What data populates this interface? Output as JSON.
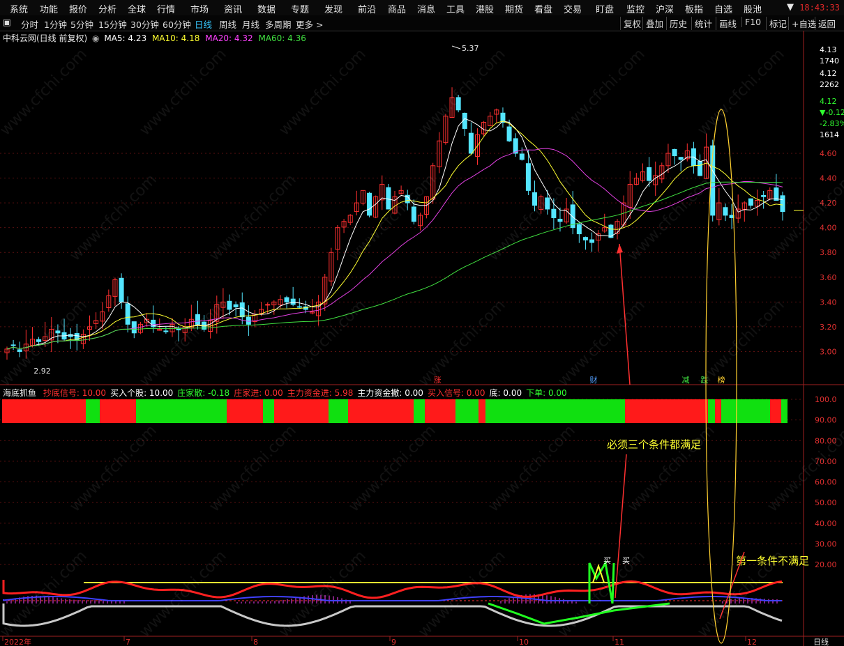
{
  "menu": [
    "系统",
    "功能",
    "报价",
    "分析",
    "全球",
    "行情",
    "市场",
    "资讯",
    "数据",
    "专题",
    "发现",
    "前沿",
    "商品",
    "消息",
    "工具",
    "港股",
    "期货",
    "看盘",
    "交易",
    "盯盘",
    "监控",
    "沪深",
    "板指",
    "自选",
    "股池"
  ],
  "clock": "18:43:33",
  "toolbar": {
    "left": [
      "分时",
      "1分钟",
      "5分钟",
      "15分钟",
      "30分钟",
      "60分钟",
      "日线",
      "周线",
      "月线",
      "多周期",
      "更多 >"
    ],
    "active": "日线",
    "right": [
      "复权",
      "叠加",
      "历史",
      "统计",
      "画线",
      "F10",
      "标记",
      "+自选",
      "返回"
    ]
  },
  "main_info": {
    "title": "中科云网(日线 前复权)",
    "ma5": "MA5: 4.23",
    "ma10": "MA10: 4.18",
    "ma20": "MA20: 4.32",
    "ma60": "MA60: 4.36"
  },
  "price_axis": {
    "ticks": [
      "4.60",
      "4.40",
      "4.20",
      "4.00",
      "3.80",
      "3.60",
      "3.40",
      "3.20",
      "3.00"
    ],
    "quote": [
      "4.13",
      "1740",
      "4.12",
      "2262",
      "4.12",
      "▼-0.12",
      "-2.83%",
      "1614"
    ]
  },
  "annotations": {
    "high": "5.37",
    "low": "2.92",
    "events": [
      "涨",
      "财",
      "减",
      "跌",
      "榜"
    ]
  },
  "sub_info": {
    "title": "海底抓鱼",
    "items": [
      {
        "label": "抄底信号: 10.00",
        "color": "#ff3030"
      },
      {
        "label": "买入个股: 10.00",
        "color": "#ffffff"
      },
      {
        "label": "庄家散: -0.18",
        "color": "#30ff30"
      },
      {
        "label": "庄家进: 0.00",
        "color": "#ff3030"
      },
      {
        "label": "主力资金进: 5.98",
        "color": "#ff3030"
      },
      {
        "label": "主力资金撤: 0.00",
        "color": "#ffffff"
      },
      {
        "label": "买入信号: 0.00",
        "color": "#ff3030"
      },
      {
        "label": "底: 0.00",
        "color": "#ffffff"
      },
      {
        "label": "下单: 0.00",
        "color": "#30ff30"
      }
    ]
  },
  "sub_axis": [
    "100.0",
    "90.00",
    "80.00",
    "70.00",
    "60.00",
    "50.00",
    "40.00",
    "30.00",
    "20.00"
  ],
  "buy_labels": [
    "买",
    "买"
  ],
  "notes": {
    "all_three": "必须三个条件都满足",
    "first_not": "第一条件不满足"
  },
  "date_axis": [
    "2022年",
    "7",
    "8",
    "9",
    "10",
    "11",
    "12"
  ],
  "period": "日线",
  "watermark": "www.cfchi.com",
  "chart_data": {
    "type": "candlestick",
    "ylim": [
      2.8,
      5.5
    ],
    "closes": [
      3.02,
      3.05,
      3.0,
      3.06,
      3.1,
      3.08,
      3.12,
      3.18,
      3.15,
      3.1,
      3.12,
      3.09,
      3.14,
      3.2,
      3.25,
      3.32,
      3.45,
      3.58,
      3.4,
      3.22,
      3.15,
      3.22,
      3.26,
      3.2,
      3.18,
      3.16,
      3.22,
      3.18,
      3.2,
      3.26,
      3.22,
      3.18,
      3.25,
      3.38,
      3.4,
      3.34,
      3.36,
      3.28,
      3.22,
      3.3,
      3.34,
      3.38,
      3.4,
      3.42,
      3.4,
      3.38,
      3.36,
      3.34,
      3.32,
      3.4,
      3.6,
      3.8,
      4.0,
      4.05,
      4.1,
      4.2,
      4.3,
      4.1,
      4.25,
      4.35,
      4.15,
      4.25,
      4.3,
      4.2,
      4.05,
      4.1,
      4.25,
      4.5,
      4.7,
      4.9,
      5.05,
      4.95,
      4.8,
      4.6,
      4.75,
      4.85,
      4.9,
      4.95,
      4.85,
      4.7,
      4.6,
      4.55,
      4.3,
      4.18,
      4.25,
      4.15,
      4.08,
      4.05,
      4.15,
      4.0,
      3.95,
      3.9,
      3.88,
      3.95,
      4.0,
      3.92,
      4.05,
      4.2,
      4.35,
      4.4,
      4.45,
      4.38,
      4.42,
      4.5,
      4.6,
      4.58,
      4.55,
      4.62,
      4.5,
      4.42,
      4.65,
      4.1,
      4.2,
      4.1,
      4.08,
      4.15,
      4.2,
      4.18,
      4.22,
      4.25,
      4.3,
      4.22,
      4.13
    ],
    "ma_colors": {
      "ma5": "#ffffff",
      "ma10": "#ffff30",
      "ma20": "#e040e0",
      "ma60": "#40e040"
    }
  }
}
